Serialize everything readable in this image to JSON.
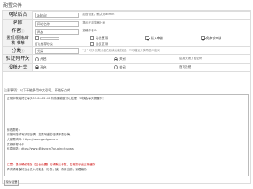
{
  "page": {
    "title": "配置文件"
  },
  "form": {
    "site": {
      "label": "网站后台",
      "value": "admin",
      "note": "后台设置。默认为admin"
    },
    "name": {
      "label": "名称",
      "value": "网站名称",
      "note": "提示在浏览器上面"
    },
    "author": {
      "label": "作者",
      "info_icon": "info-icon",
      "value": "网友",
      "note": "投稿作者ID"
    },
    "top": {
      "label": "置顶/跟随/审核 推荐",
      "options": [
        {
          "label": "",
          "checked": false
        },
        {
          "label": "分类置顶",
          "checked": false
        },
        {
          "label": "插入审核",
          "checked": true
        },
        {
          "label": "免审核审核",
          "checked": true
        },
        {
          "label": "打包推荐分类",
          "checked": false
        },
        {
          "label": "首页置顶",
          "checked": false
        }
      ]
    },
    "category": {
      "label": "分类",
      "info_icon": "info-icon",
      "value": "分类",
      "note": "\"分\" 可多分类分组在后续功能找回，不可增加分类再选中定义"
    },
    "verify": {
      "label": "验证码开关",
      "options": [
        {
          "label": "开启",
          "selected": false
        },
        {
          "label": "关闭",
          "selected": true
        }
      ],
      "note": "启用关闭了验证码"
    },
    "submit": {
      "label": "投稿开关",
      "options": [
        {
          "label": "开启",
          "selected": true
        },
        {
          "label": "关闭",
          "selected": false
        }
      ],
      "note": "首页投稿"
    }
  },
  "notice_section": {
    "title": "注意事项：以下不能多用中文引号，不能标点的",
    "lines": [
      {
        "text": "正常审核始终在每天09:00-22:00 有随便能做可以处理，审核会每天提醒作！",
        "accent": false
      },
      {
        "text": "修改帮助：",
        "accent": false
      },
      {
        "text": "请按网站填写好您留情，如果写错的话请不要后悔。",
        "accent": false
      },
      {
        "text": "大家需求网: https://www.gadiga.com",
        "accent": false
      },
      {
        "text": "资源群组QQ: ",
        "accent": false
      },
      {
        "text": "信息网站: https://www.45bsy.cn/?plugin=trugas",
        "accent": false
      },
      {
        "text": "注意：提示确保增加【后台设置】后得默认参数，否则提示出正常缓存",
        "accent": true
      },
      {
        "text": "再次请确保好后台进入可能会（分集，缺）再用当前，请看编码",
        "accent": false
      }
    ]
  },
  "footer": {
    "save_label": "保存设置"
  }
}
